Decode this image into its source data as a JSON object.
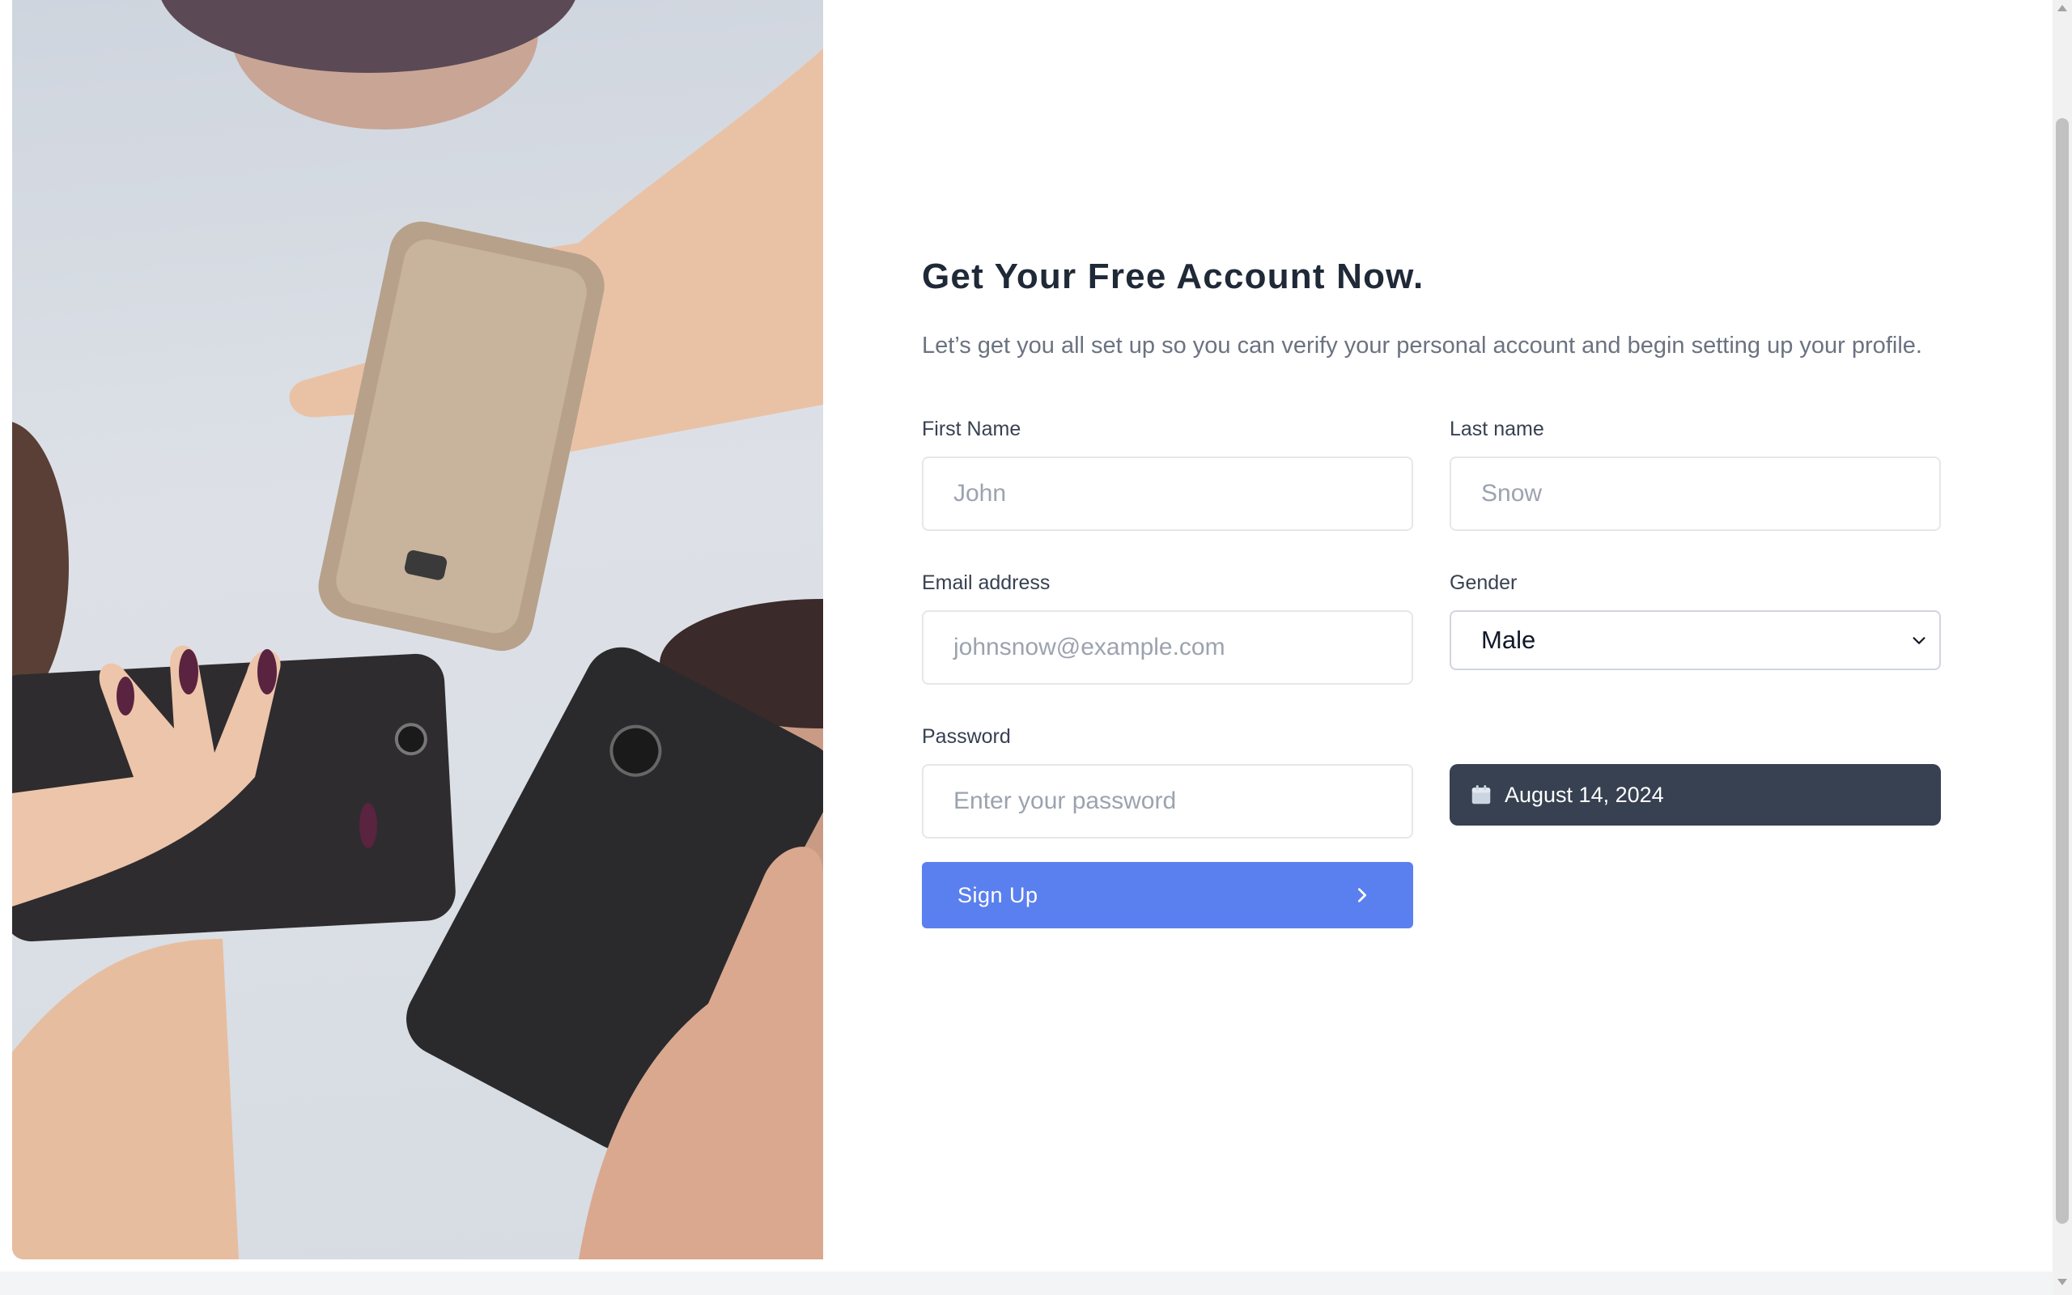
{
  "form": {
    "title": "Get Your Free Account Now.",
    "subtitle": "Let’s get you all set up so you can verify your personal account and begin setting up your profile.",
    "first_name": {
      "label": "First Name",
      "placeholder": "John"
    },
    "last_name": {
      "label": "Last name",
      "placeholder": "Snow"
    },
    "email": {
      "label": "Email address",
      "placeholder": "johnsnow@example.com"
    },
    "gender": {
      "label": "Gender",
      "value": "Male"
    },
    "password": {
      "label": "Password",
      "placeholder": "Enter your password"
    },
    "date": {
      "value": "August 14, 2024",
      "icon": "calendar-icon"
    },
    "submit": {
      "label": "Sign Up",
      "icon": "chevron-right-icon"
    }
  },
  "colors": {
    "primary_button": "#5a7fef",
    "date_button": "#374151",
    "title": "#1f2937",
    "subtitle": "#6b7280"
  }
}
